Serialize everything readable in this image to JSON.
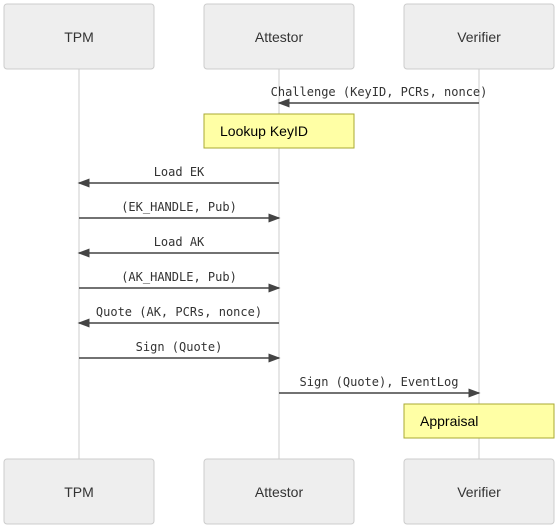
{
  "actors": [
    "TPM",
    "Attestor",
    "Verifier"
  ],
  "messages": [
    {
      "from": 2,
      "to": 1,
      "label": "Challenge (KeyID, PCRs, nonce)"
    },
    {
      "note": true,
      "over": 1,
      "label": "Lookup KeyID"
    },
    {
      "from": 1,
      "to": 0,
      "label": "Load EK"
    },
    {
      "from": 0,
      "to": 1,
      "label": "(EK_HANDLE, Pub)"
    },
    {
      "from": 1,
      "to": 0,
      "label": "Load AK"
    },
    {
      "from": 0,
      "to": 1,
      "label": "(AK_HANDLE, Pub)"
    },
    {
      "from": 1,
      "to": 0,
      "label": "Quote (AK, PCRs, nonce)"
    },
    {
      "from": 0,
      "to": 1,
      "label": "Sign (Quote)"
    },
    {
      "from": 1,
      "to": 2,
      "label": "Sign (Quote), EventLog"
    },
    {
      "note": true,
      "over": 2,
      "label": "Appraisal"
    }
  ],
  "colors": {
    "actor_fill": "#eeeeee",
    "note_fill": "#ffffa5",
    "line": "#444444"
  }
}
